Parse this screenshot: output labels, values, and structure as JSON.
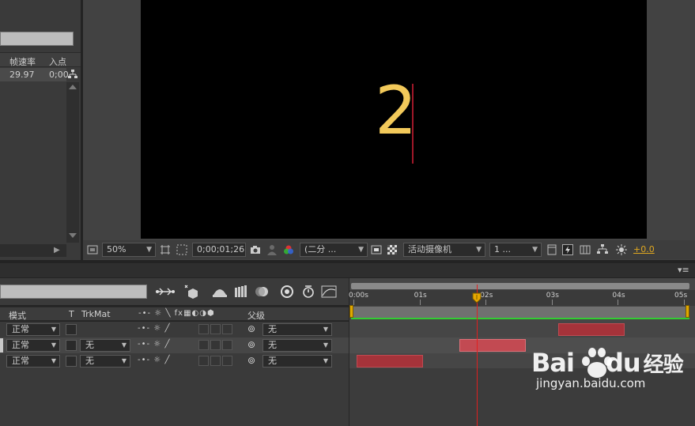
{
  "project_panel": {
    "columns": [
      "帧速率",
      "入点"
    ],
    "row": {
      "frame_rate": "29.97",
      "in_point": "0;00"
    }
  },
  "viewer": {
    "comp_text": "2",
    "zoom": "50%",
    "timecode": "0;00;01;26",
    "resolution": "(二分 ...",
    "camera": "活动摄像机",
    "views": "1 ...",
    "exposure": "+0.0"
  },
  "timeline": {
    "columns": {
      "mode": "模式",
      "t": "T",
      "trkmat": "TrkMat",
      "parent": "父级"
    },
    "layers": [
      {
        "mode": "正常",
        "trkmat": "",
        "parent": "无"
      },
      {
        "mode": "正常",
        "trkmat": "无",
        "parent": "无"
      },
      {
        "mode": "正常",
        "trkmat": "无",
        "parent": "无"
      }
    ],
    "ruler": [
      "0:00s",
      "01s",
      "02s",
      "03s",
      "04s",
      "05s"
    ],
    "playhead_seconds": 1.87,
    "clips": [
      {
        "start_s": 3.1,
        "end_s": 4.1
      },
      {
        "start_s": 1.6,
        "end_s": 2.6
      },
      {
        "start_s": 0.05,
        "end_s": 1.05
      }
    ]
  },
  "watermark": {
    "logo": "Bai",
    "logo_suffix": "du",
    "brand": "经验",
    "url": "jingyan.baidu.com"
  },
  "colors": {
    "comp_text": "#f2c95a",
    "playhead": "#e02020",
    "clip": "#a5333a",
    "work_area_line": "#33cc33"
  }
}
